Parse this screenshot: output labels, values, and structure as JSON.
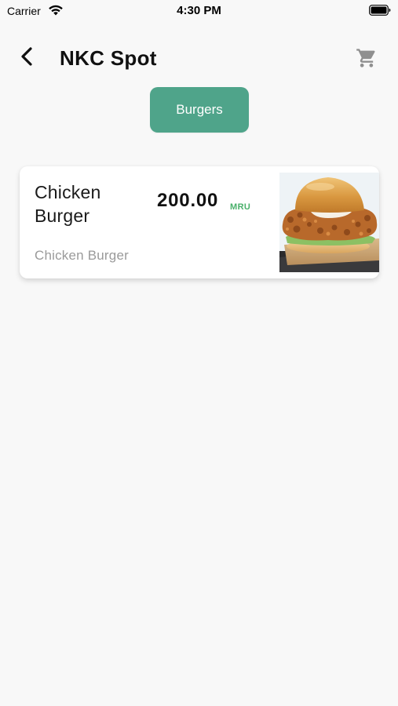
{
  "status_bar": {
    "carrier": "Carrier",
    "time": "4:30 PM",
    "icons": [
      "wifi-icon",
      "battery-icon"
    ]
  },
  "header": {
    "title": "NKC Spot",
    "back_icon": "chevron-left-icon",
    "cart_icon": "shopping-cart-icon"
  },
  "categories": [
    {
      "label": "Burgers",
      "selected": true
    }
  ],
  "products": [
    {
      "name": "Chicken Burger",
      "price": "200.00",
      "currency": "MRU",
      "subtitle": "Chicken Burger",
      "image": "chicken-burger-photo"
    }
  ],
  "colors": {
    "accent": "#4fa48a",
    "currency": "#49b06a",
    "background": "#f8f8f8"
  }
}
